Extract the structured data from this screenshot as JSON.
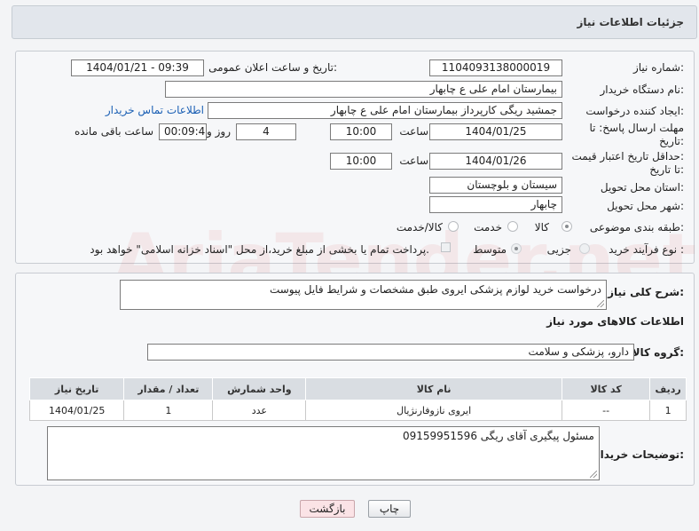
{
  "header": {
    "title": "جزئیات اطلاعات نیاز"
  },
  "form": {
    "need_number_label": "شماره نیاز:",
    "need_number": "1104093138000019",
    "announce_label": "تاریخ و ساعت اعلان عمومی:",
    "announce_value": "1404/01/21 - 09:39",
    "buyer_org_label": "نام دستگاه خریدار:",
    "buyer_org": "بیمارستان امام علی  ع  چابهار",
    "creator_label": "ایجاد کننده درخواست:",
    "creator": "جمشید ریگی کارپرداز بیمارستان امام علی  ع  چابهار",
    "contact_link": "اطلاعات تماس خریدار",
    "deadline_label_1": "مهلت ارسال پاسخ: تا",
    "deadline_label_2": "تاریخ:",
    "deadline_date": "1404/01/25",
    "hour_label": "ساعت",
    "deadline_time": "10:00",
    "days_value": "4",
    "days_label": "روز و",
    "remaining_time": "00:09:47",
    "remaining_label": "ساعت باقی مانده",
    "min_price_label_1": "حداقل تاریخ اعتبار قیمت:",
    "min_price_label_2": "تا تاریخ:",
    "validity_date": "1404/01/26",
    "validity_time": "10:00",
    "province_label": "استان محل تحویل:",
    "province": "سیستان و بلوچستان",
    "city_label": "شهر محل تحویل:",
    "city": "چابهار",
    "category_label": "طبقه بندی موضوعی:",
    "category_options": [
      "کالا",
      "خدمت",
      "کالا/خدمت"
    ],
    "process_label": "نوع فرآیند خرید :",
    "process_options": [
      "جزیی",
      "متوسط"
    ],
    "payment_note": "پرداخت تمام یا بخشی از مبلغ خرید،از محل \"اسناد خزانه اسلامی\" خواهد بود."
  },
  "details": {
    "description_label": "شرح کلی نیاز:",
    "description": "درخواست خرید لوازم پزشکی ایروی طبق مشخصات و شرایط فایل پیوست",
    "goods_info_title": "اطلاعات کالاهای مورد نیاز",
    "goods_group_label": "گروه کالا:",
    "goods_group": "دارو، پزشکی و سلامت",
    "table": {
      "headers": [
        "ردیف",
        "کد کالا",
        "نام کالا",
        "واحد شمارش",
        "تعداد / مقدار",
        "تاریخ نیاز"
      ],
      "rows": [
        [
          "1",
          "--",
          "ایروی نازوفارنژیال",
          "عدد",
          "1",
          "1404/01/25"
        ]
      ]
    },
    "buyer_notes_label": "توضیحات خریدار:",
    "buyer_notes": "مسئول پیگیری آقای ریگی 09159951596"
  },
  "buttons": {
    "print": "چاپ",
    "back": "بازگشت"
  },
  "watermark": {
    "text": "AriaTender.net"
  },
  "colors": {
    "link": "#1a5fb4",
    "header_bg": "#e2e6ec",
    "back_button_bg": "#fbe3e6"
  }
}
